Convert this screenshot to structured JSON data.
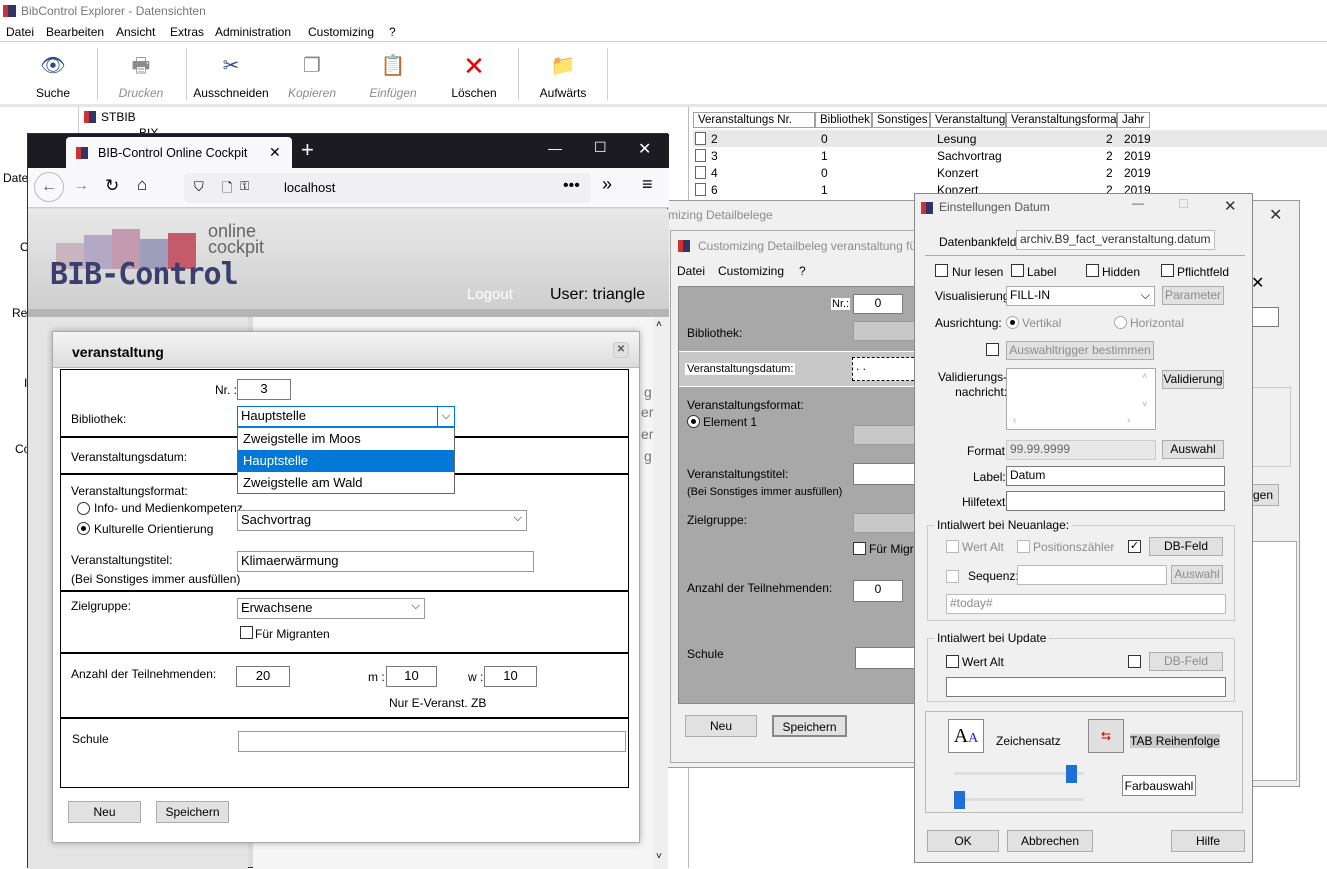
{
  "explorer": {
    "title": "BibControl Explorer - Datensichten",
    "menu": [
      "Datei",
      "Bearbeiten",
      "Ansicht",
      "Extras",
      "Administration",
      "Customizing",
      "?"
    ],
    "toolbar": [
      {
        "label": "Suche",
        "icon": "binoculars-icon",
        "enabled": true
      },
      {
        "label": "Drucken",
        "icon": "printer-icon",
        "enabled": false
      },
      {
        "label": "Ausschneiden",
        "icon": "scissors-icon",
        "enabled": true
      },
      {
        "label": "Kopieren",
        "icon": "copy-icon",
        "enabled": false
      },
      {
        "label": "Einfügen",
        "icon": "paste-icon",
        "enabled": false
      },
      {
        "label": "Löschen",
        "icon": "delete-x-icon",
        "enabled": true
      },
      {
        "label": "Aufwärts",
        "icon": "folder-up-icon",
        "enabled": true
      }
    ],
    "tree": {
      "root": "STBIB",
      "child": "BIX"
    },
    "side_labels": [
      "Date",
      "O",
      "Re",
      "I",
      "Co"
    ],
    "table": {
      "columns": [
        "Veranstaltungs Nr.",
        "Bibliothek",
        "Sonstiges",
        "Veranstaltung",
        "Veranstaltungsformat",
        "Jahr"
      ],
      "rows": [
        [
          "2",
          "0",
          "",
          "Lesung",
          "2",
          "2019"
        ],
        [
          "3",
          "1",
          "",
          "Sachvortrag",
          "2",
          "2019"
        ],
        [
          "4",
          "0",
          "",
          "Konzert",
          "2",
          "2019"
        ],
        [
          "6",
          "1",
          "",
          "Konzert",
          "2",
          "2019"
        ]
      ]
    }
  },
  "customizing": {
    "title_outer": "mizing Detailbelege",
    "title_inner": "Customizing Detailbeleg veranstaltung fü",
    "menu": [
      "Datei",
      "Customizing",
      "?"
    ],
    "nr_label": "Nr.:",
    "nr_value": "0",
    "bibliothek": "Bibliothek:",
    "datum": "Veranstaltungsdatum:",
    "datum_value": ". .",
    "format": "Veranstaltungsformat:",
    "element": "Element 1",
    "titel": "Veranstaltungstitel:",
    "titel_hint": "(Bei Sonstiges immer ausfüllen)",
    "zielgruppe": "Zielgruppe:",
    "migranten": "Für Migran",
    "anzahl": "Anzahl der Teilnehmenden:",
    "anzahl_value": "0",
    "schule": "Schule",
    "neu": "Neu",
    "speichern": "Speichern"
  },
  "settings": {
    "title": "Einstellungen Datum",
    "datenbankfeld_label": "Datenbankfeld:",
    "datenbankfeld": "archiv.B9_fact_veranstaltung.datum",
    "checks": [
      "Nur lesen",
      "Label",
      "Hidden",
      "Pflichtfeld"
    ],
    "visualisierung_label": "Visualisierung:",
    "visualisierung": "FILL-IN",
    "parameter": "Parameter",
    "ausrichtung_label": "Ausrichtung:",
    "vertikal": "Vertikal",
    "horizontal": "Horizontal",
    "auswahltrigger": "Auswahltrigger bestimmen",
    "validierung_label": "Validierungs-\nnachricht:",
    "validierung_btn": "Validierung",
    "format_label": "Format:",
    "format_value": "99.99.9999",
    "auswahl": "Auswahl",
    "label_label": "Label:",
    "label_value": "Datum",
    "hilfetext_label": "Hilfetext:",
    "neuanlage_title": "Intialwert bei Neuanlage:",
    "wert_alt": "Wert Alt",
    "positionszaehler": "Positionszähler",
    "db_feld": "DB-Feld",
    "sequenz": "Sequenz:",
    "auswahl2": "Auswahl",
    "today": "#today#",
    "update_title": "Intialwert bei Update",
    "wert_alt2": "Wert Alt",
    "db_feld2": "DB-Feld",
    "zeichensatz": "Zeichensatz",
    "tab_reihenfolge": "TAB Reihenfolge",
    "farbauswahl": "Farbauswahl",
    "ok": "OK",
    "abbrechen": "Abbrechen",
    "hilfe": "Hilfe"
  },
  "back_dialog": {
    "partial_button": "gen"
  },
  "browser": {
    "tab_title": "BIB-Control Online Cockpit",
    "url": "localhost",
    "logo_main": "BIB-Control",
    "logo_online": "online",
    "logo_cockpit": "cockpit",
    "logout": "Logout",
    "user": "User: triangle",
    "side_letters": [
      "g",
      "er",
      "er",
      "g"
    ]
  },
  "form": {
    "title": "veranstaltung",
    "nr_label": "Nr. :",
    "nr_value": "3",
    "bibliothek_label": "Bibliothek:",
    "bibliothek_value": "Hauptstelle",
    "dropdown_options": [
      "Zweigstelle im Moos",
      "Hauptstelle",
      "Zweigstelle am Wald"
    ],
    "dropdown_selected": 1,
    "datum_label": "Veranstaltungsdatum:",
    "format_label": "Veranstaltungsformat:",
    "radio1": "Info- und Medienkompetenz",
    "radio2": "Kulturelle Orientierung",
    "format_value": "Sachvortrag",
    "titel_label": "Veranstaltungstitel:",
    "titel_hint": "(Bei Sonstiges immer ausfüllen)",
    "titel_value": "Klimaerwärmung",
    "zielgruppe_label": "Zielgruppe:",
    "zielgruppe_value": "Erwachsene",
    "migranten": "Für Migranten",
    "anzahl_label": "Anzahl der Teilnehmenden:",
    "anzahl_value": "20",
    "m_label": "m :",
    "m_value": "10",
    "w_label": "w :",
    "w_value": "10",
    "nur_e": "Nur E-Veranst. ZB",
    "schule_label": "Schule",
    "neu": "Neu",
    "speichern": "Speichern"
  }
}
